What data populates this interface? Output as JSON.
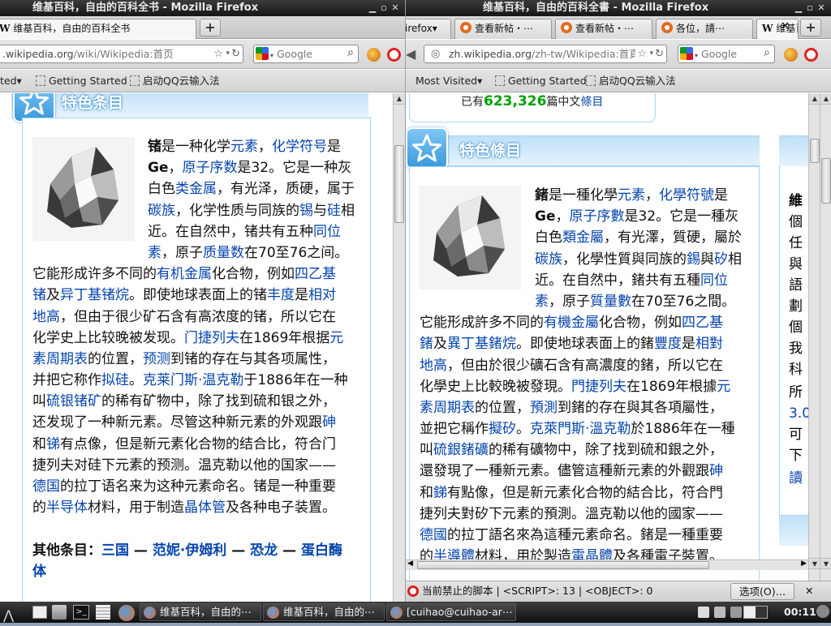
{
  "left": {
    "title": "维基百科，自由的百科全书 - Mozilla Firefox",
    "tab": "维基百科，自由的百科全书",
    "url_domain": ".wikipedia.org",
    "url_path": "/wiki/Wikipedia:首页",
    "search_placeholder": "Google",
    "bookmarks": [
      "ted",
      "Getting Started",
      "启动QQ云输入法"
    ],
    "section_title": "特色条目",
    "lines": [
      [
        "b:锗",
        "是一种化学",
        "a:元素",
        "，",
        "a:化学符号",
        "是"
      ],
      [
        "b:Ge",
        "，",
        "a:原子序数",
        "是32。它是一种灰"
      ],
      [
        "白色",
        "a:类金属",
        "，有光泽，质硬，属于"
      ],
      [
        "a:碳族",
        "，化学性质与同族的",
        "a:锡",
        "与",
        "a:硅",
        "相"
      ],
      [
        "近。在自然中，锗共有五种",
        "a:同位"
      ],
      [
        "a:素",
        "，原子",
        "a:质量数",
        "在70至76之间。"
      ],
      [
        "它能形成许多不同的",
        "a:有机金属",
        "化合物，例如",
        "a:四乙基"
      ],
      [
        "a:锗",
        "及",
        "a:异丁基锗烷",
        "。即使地球表面上的锗",
        "a:丰度",
        "是",
        "a:相对"
      ],
      [
        "a:地高",
        "，但由于很少矿石含有高浓度的锗，所以它在"
      ],
      [
        "化学史上比较晚被发现。",
        "a:门捷列夫",
        "在1869年根据",
        "a:元"
      ],
      [
        "a:素周期表",
        "的位置，",
        "a:预测",
        "到锗的存在与其各项属性，"
      ],
      [
        "并把它称作",
        "a:拟硅",
        "。",
        "a:克莱门斯·温克勒",
        "于1886年在一种"
      ],
      [
        "叫",
        "a:硫银锗矿",
        "的稀有矿物中，除了找到硫和银之外，"
      ],
      [
        "还发现了一种新元素。尽管这种新元素的外观跟",
        "a:砷"
      ],
      [
        "和",
        "a:锑",
        "有点像，但是新元素化合物的结合比，符合门"
      ],
      [
        "捷列夫对硅下元素的预测。温克勒以他的国家——"
      ],
      [
        "a:德国",
        "的拉丁语名来为这种元素命名。锗是一种重要"
      ],
      [
        "的",
        "a:半导体",
        "材料，用于制造",
        "a:晶体管",
        "及各种电子装置。"
      ],
      [
        ""
      ],
      [
        "b:其他条目：",
        "ba:三国",
        "b: — ",
        "ba:范妮·伊姆利",
        "b: — ",
        "ba:恐龙",
        "b: — ",
        "ba:蛋白酶"
      ],
      [
        "ba:体"
      ]
    ]
  },
  "right": {
    "title": "维基百科，自由的百科全書 - Mozilla Firefox",
    "tabs": [
      "irefox",
      "查看新帖・⋯",
      "查看新帖・⋯",
      "各位，請⋯",
      "维基百⋯"
    ],
    "url_domain": "zh.wikipedia.org",
    "url_path": "/zh-tw/Wikipedia:首頁",
    "search_placeholder": "Google",
    "bookmarks": [
      "Most Visited",
      "Getting Started",
      "启动QQ云输入法"
    ],
    "counter_prefix": "已有",
    "counter_number": "623,326",
    "counter_mid": "篇中文",
    "counter_link": "條目",
    "section_title": "特色條目",
    "lines": [
      [
        "b:鍺",
        "是一種化學",
        "a:元素",
        "，",
        "a:化學符號",
        "是"
      ],
      [
        "b:Ge",
        "，",
        "a:原子序數",
        "是32。它是一種灰"
      ],
      [
        "白色",
        "a:類金屬",
        "，有光澤，質硬，屬於"
      ],
      [
        "a:碳族",
        "，化學性質與同族的",
        "a:錫",
        "與",
        "a:矽",
        "相"
      ],
      [
        "近。在自然中，鍺共有五種",
        "a:同位"
      ],
      [
        "a:素",
        "，原子",
        "a:質量數",
        "在70至76之間。"
      ],
      [
        "它能形成許多不同的",
        "a:有機金屬",
        "化合物，例如",
        "a:四乙基"
      ],
      [
        "a:鍺",
        "及",
        "a:異丁基鍺烷",
        "。即使地球表面上的鍺",
        "a:豐度",
        "是",
        "a:相對"
      ],
      [
        "a:地高",
        "，但由於很少礦石含有高濃度的鍺，所以它在"
      ],
      [
        "化學史上比較晚被發現。",
        "a:門捷列夫",
        "在1869年根據",
        "a:元"
      ],
      [
        "a:素周期表",
        "的位置，",
        "a:預測",
        "到鍺的存在與其各項屬性，"
      ],
      [
        "並把它稱作",
        "a:擬矽",
        "。",
        "a:克萊門斯·溫克勒",
        "於1886年在一種"
      ],
      [
        "叫",
        "a:硫銀鍺礦",
        "的稀有礦物中，除了找到硫和銀之外，"
      ],
      [
        "還發現了一種新元素。儘管這種新元素的外觀跟",
        "a:砷"
      ],
      [
        "和",
        "a:銻",
        "有點像，但是新元素化合物的結合比，符合門"
      ],
      [
        "捷列夫對矽下元素的預測。溫克勒以他的國家——"
      ],
      [
        "a:德國",
        "的拉丁語名來為這種元素命名。鍺是一種重要"
      ],
      [
        "的",
        "a:半導體",
        "材料，用於製造",
        "a:電晶體",
        "及各種電子裝置。"
      ]
    ],
    "side_chars": [
      "維",
      "個",
      "任",
      "與",
      "語",
      "劃",
      "個",
      "我",
      "科",
      "所",
      "3.0",
      "可",
      "下",
      "讀"
    ],
    "status_text": "当前禁止的脚本 | <SCRIPT>: 13 | <OBJECT>: 0",
    "options_button": "选项(O)…"
  },
  "taskbar": {
    "tasks": [
      "维基百科，自由的⋯",
      "维基百科，自由的⋯",
      "[cuihao@cuihao-ar⋯"
    ],
    "clock": "00:11"
  }
}
